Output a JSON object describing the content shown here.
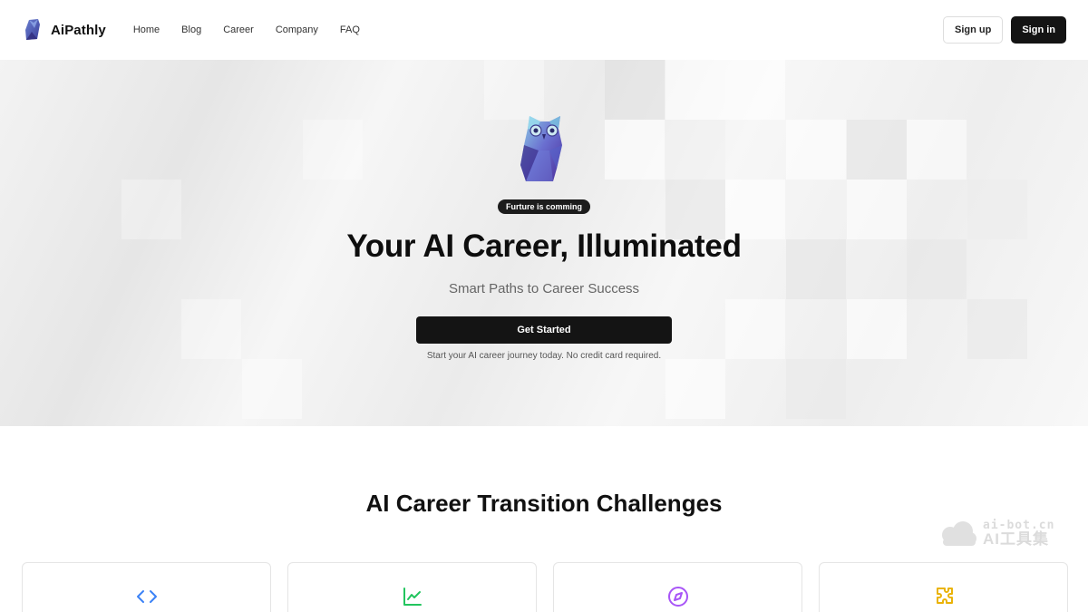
{
  "nav": {
    "brand": "AiPathly",
    "links": [
      "Home",
      "Blog",
      "Career",
      "Company",
      "FAQ"
    ],
    "signup_label": "Sign up",
    "signin_label": "Sign in"
  },
  "hero": {
    "badge": "Furture is comming",
    "title": "Your AI Career, Illuminated",
    "subtitle": "Smart Paths to Career Success",
    "cta_label": "Get Started",
    "note": "Start your AI career journey today. No credit card required."
  },
  "section": {
    "title": "AI Career Transition Challenges",
    "cards": [
      {
        "icon": "code-icon",
        "color": "#3b82f6"
      },
      {
        "icon": "chart-line-icon",
        "color": "#22c55e"
      },
      {
        "icon": "compass-icon",
        "color": "#a855f7"
      },
      {
        "icon": "puzzle-icon",
        "color": "#eab308"
      }
    ]
  },
  "watermark": {
    "url": "ai-bot.cn",
    "text": "AI工具集"
  }
}
